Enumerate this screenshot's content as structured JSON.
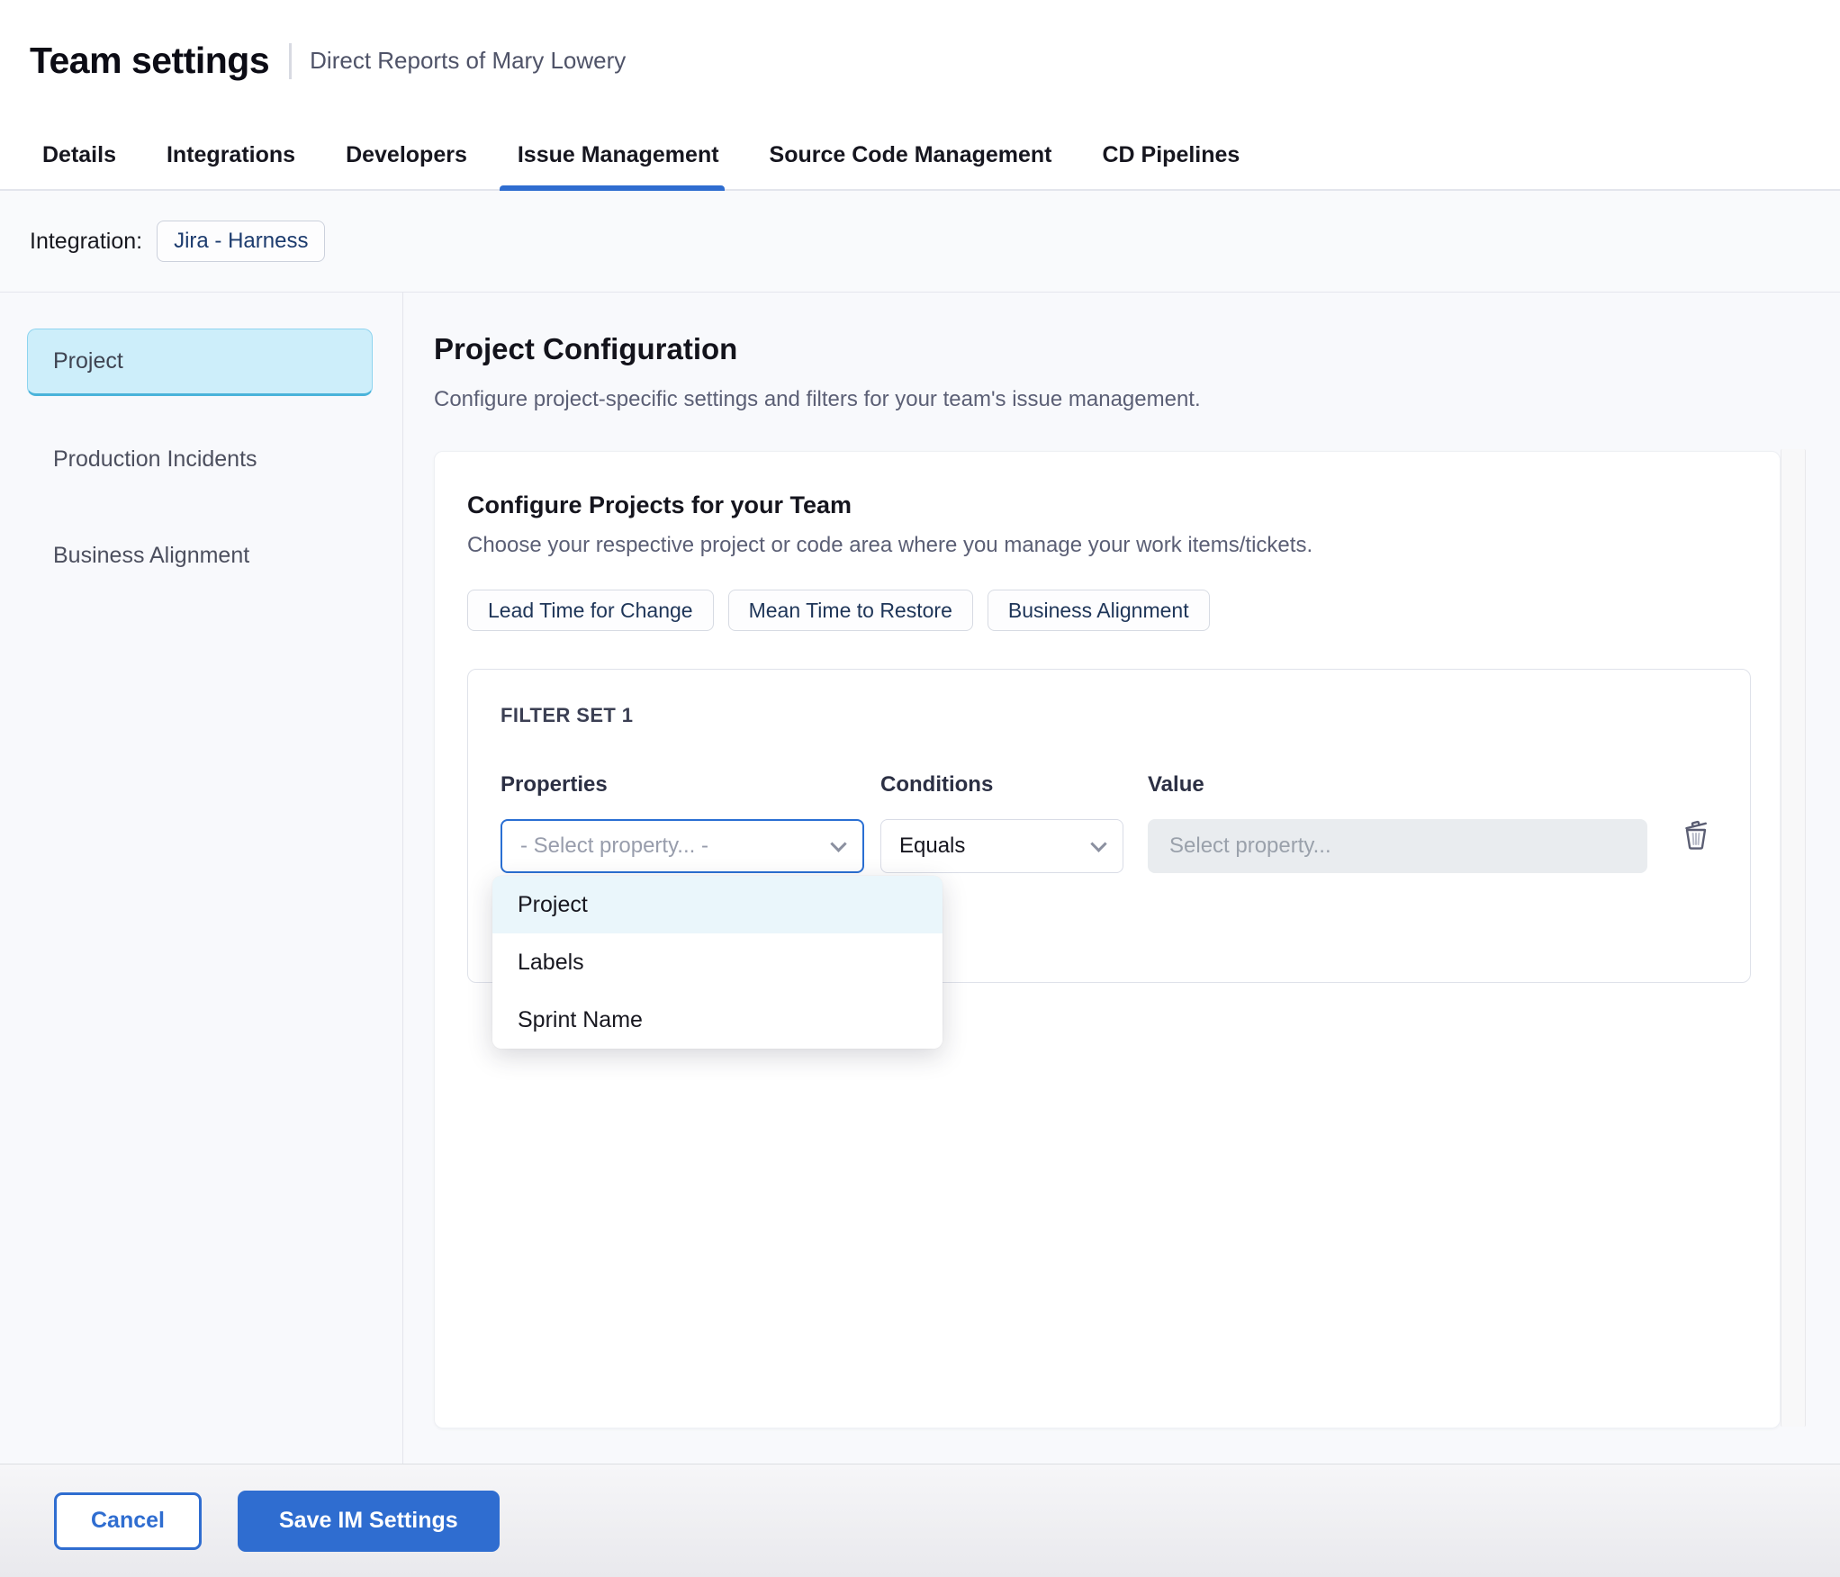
{
  "header": {
    "title": "Team settings",
    "subtitle": "Direct Reports of Mary Lowery"
  },
  "tabs": [
    {
      "label": "Details",
      "active": false
    },
    {
      "label": "Integrations",
      "active": false
    },
    {
      "label": "Developers",
      "active": false
    },
    {
      "label": "Issue Management",
      "active": true
    },
    {
      "label": "Source Code Management",
      "active": false
    },
    {
      "label": "CD Pipelines",
      "active": false
    }
  ],
  "integration": {
    "label": "Integration:",
    "chip": "Jira - Harness"
  },
  "sidebar": {
    "items": [
      {
        "label": "Project",
        "selected": true
      },
      {
        "label": "Production Incidents",
        "selected": false
      },
      {
        "label": "Business Alignment",
        "selected": false
      }
    ]
  },
  "main": {
    "title": "Project Configuration",
    "description": "Configure project-specific settings and filters for your team's issue management.",
    "card": {
      "title": "Configure Projects for your Team",
      "description": "Choose your respective project or code area where you manage your work items/tickets.",
      "pills": [
        {
          "label": "Lead Time for Change"
        },
        {
          "label": "Mean Time to Restore"
        },
        {
          "label": "Business Alignment"
        }
      ],
      "filter_set": {
        "title": "FILTER SET 1",
        "columns": {
          "properties": "Properties",
          "conditions": "Conditions",
          "value": "Value"
        },
        "property_placeholder": "- Select property... -",
        "condition_value": "Equals",
        "value_placeholder": "Select property..."
      },
      "dropdown": {
        "highlighted": "Project",
        "options": [
          {
            "label": "Project",
            "highlighted": true
          },
          {
            "label": "Labels",
            "highlighted": false
          },
          {
            "label": "Sprint Name",
            "highlighted": false
          }
        ]
      }
    }
  },
  "footer": {
    "cancel_label": "Cancel",
    "save_label": "Save IM Settings"
  },
  "colors": {
    "primary_blue": "#2f6dd0",
    "tab_underline": "#2f6dd0",
    "selected_nav_bg": "#cdeefa",
    "selected_nav_border": "#4ab3da",
    "dropdown_highlight": "#eaf6fb",
    "content_bg": "#f8f9fc",
    "disabled_input_bg": "#e9ecef",
    "chip_text": "#1c3b6e"
  }
}
